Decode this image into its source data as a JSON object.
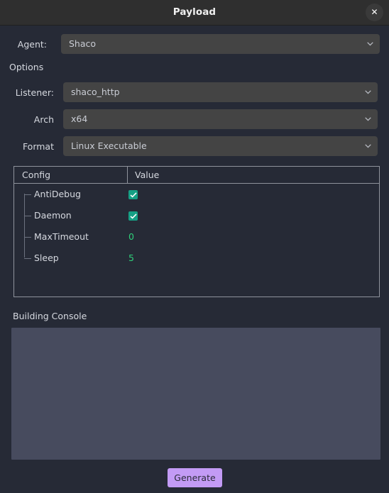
{
  "window": {
    "title": "Payload",
    "close_icon": "close-icon",
    "close_label": "✕"
  },
  "form": {
    "agent": {
      "label": "Agent:",
      "value": "Shaco"
    },
    "options_label": "Options",
    "listener": {
      "label": "Listener:",
      "value": "shaco_http"
    },
    "arch": {
      "label": "Arch",
      "value": "x64"
    },
    "format": {
      "label": "Format",
      "value": "Linux Executable"
    }
  },
  "config_table": {
    "headers": [
      "Config",
      "Value"
    ],
    "rows": [
      {
        "name": "AntiDebug",
        "type": "checkbox",
        "checked": true,
        "value": ""
      },
      {
        "name": "Daemon",
        "type": "checkbox",
        "checked": true,
        "value": ""
      },
      {
        "name": "MaxTimeout",
        "type": "text",
        "checked": false,
        "value": "0"
      },
      {
        "name": "Sleep",
        "type": "text",
        "checked": false,
        "value": "5"
      }
    ]
  },
  "console": {
    "label": "Building Console",
    "value": "",
    "placeholder": ""
  },
  "actions": {
    "generate_label": "Generate"
  },
  "colors": {
    "window_bg": "#262a36",
    "titlebar_bg": "#2f2f2f",
    "combo_bg": "#444444",
    "console_bg": "#474b5e",
    "accent_button": "#c39bf5",
    "checkbox_green": "#16a085",
    "value_green": "#2fd07a",
    "border": "#8f939c"
  }
}
